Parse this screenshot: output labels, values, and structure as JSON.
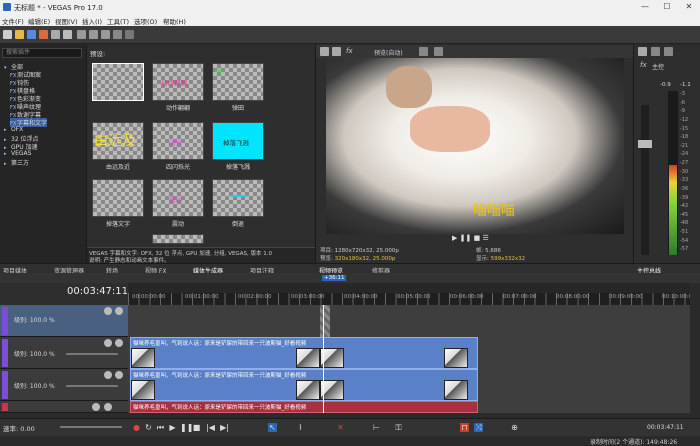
{
  "window": {
    "title": "无标题 * - VEGAS Pro 17.0",
    "minimize": "—",
    "maximize": "☐",
    "close": "✕"
  },
  "menu": [
    "文件(F)",
    "编辑(E)",
    "视图(V)",
    "插入(I)",
    "工具(T)",
    "选项(O)",
    "帮助(H)"
  ],
  "fx_panel": {
    "search_placeholder": "搜索插件",
    "preset_header": "预设:",
    "tree": [
      "全部",
      "测试图案",
      "钝伤",
      "棋盘格",
      "色彩渐变",
      "噪声纹理",
      "致谢字幕",
      "字幕和文字",
      "OFX",
      "32 位浮点",
      "GPU 加速",
      "VEGAS",
      "第三方"
    ],
    "presets": [
      {
        "name": "",
        "text": ""
      },
      {
        "name": "动作翩翩",
        "text": "动作翩翩"
      },
      {
        "name": "弹田",
        "text": "弹"
      },
      {
        "name": "由远及近",
        "text": "由远及"
      },
      {
        "name": "四闪烁光",
        "text": "闪光"
      },
      {
        "name": "掉落飞溅",
        "text": "掉落飞溅"
      },
      {
        "name": "掉落文字",
        "text": ""
      },
      {
        "name": "震动",
        "text": "震动"
      },
      {
        "name": "倒退",
        "text": ""
      },
      {
        "name": "",
        "text": ""
      }
    ],
    "description": "VEGAS 字幕和文字: OFX, 32 位 浮点, GPU 加速, 分组, VEGAS, 版本 1.0",
    "description2": "说明: 产生静态和动画文本事件。"
  },
  "left_tabs": [
    "项目媒体",
    "资源管理器",
    "转场",
    "视频 FX",
    "媒体生成器",
    "项目注释"
  ],
  "preview": {
    "toolbar_label": "预览(自动)",
    "overlay_text": "喵喵喵",
    "project_label": "项目:",
    "project_value": "1280x720x32, 25.000p",
    "preview_label": "预览:",
    "preview_value": "320x180x32, 25.000p",
    "frame_label": "帧:",
    "frame_value": "5,686",
    "display_label": "显示:",
    "display_value": "599x332x32",
    "tabs": [
      "视频预览",
      "修剪器"
    ]
  },
  "master": {
    "label": "主控",
    "db_left": "-0.9",
    "db_right": "-1.1",
    "tab": "主控总线",
    "scale": [
      "-3",
      "-6",
      "-9",
      "-12",
      "-15",
      "-18",
      "-21",
      "-24",
      "-27",
      "-30",
      "-33",
      "-36",
      "-39",
      "-42",
      "-45",
      "-48",
      "-51",
      "-54",
      "-57"
    ],
    "levels": {
      "left": 0.55,
      "right": 0.55
    }
  },
  "timeline": {
    "timecode": "00:03:47:11",
    "cursor_marker": "+36:11",
    "ticks": [
      "00:00:00:00",
      "00:01:00:00",
      "00:02:00:00",
      "00:03:00:00",
      "00:04:00:00",
      "00:05:00:00",
      "00:06:00:00",
      "00:07:00:00",
      "00:08:00:00",
      "00:09:00:00",
      "00:10:00:00"
    ],
    "tracks": [
      {
        "level": "级别: 100.0 %",
        "type": "video"
      },
      {
        "level": "级别: 100.0 %",
        "type": "video"
      },
      {
        "level": "级别: 100.0 %",
        "type": "video"
      }
    ],
    "clip_title": "猫咪养毛皇叫，气到说人话：原来是铲屎的带回来一只波斯猫_好看视频",
    "rate": "速率: 0.00",
    "end_time": "00:03:47:11"
  },
  "status": {
    "recording_time": "录制时间(2 个通道): 149:48:26"
  },
  "colors": {
    "accent": "#2c66b8",
    "clip": "#5a80c8",
    "audio_clip": "#a83040",
    "cyan_preset": "#00e5ff"
  }
}
